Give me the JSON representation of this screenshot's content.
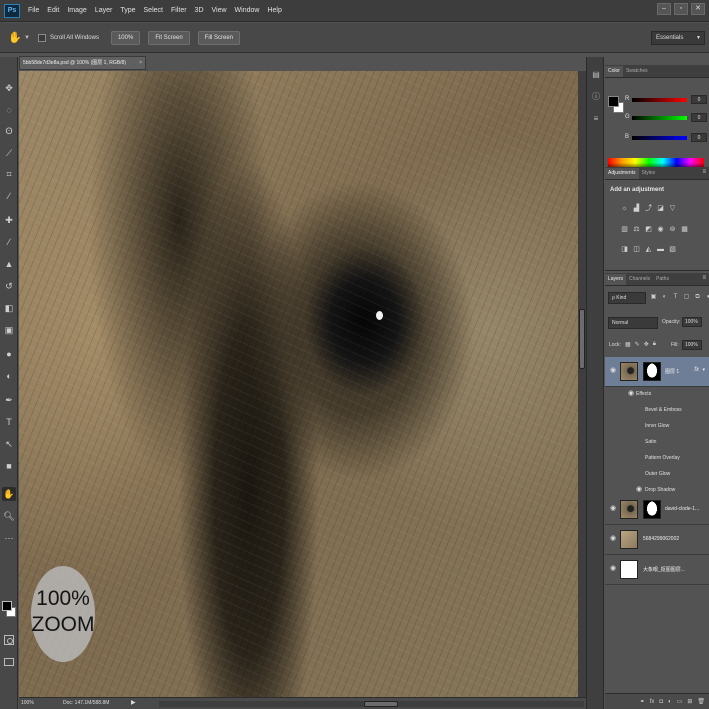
{
  "app": {
    "logo": "Ps"
  },
  "menu": [
    "File",
    "Edit",
    "Image",
    "Layer",
    "Type",
    "Select",
    "Filter",
    "3D",
    "View",
    "Window",
    "Help"
  ],
  "window_buttons": {
    "minimize": "–",
    "restore": "▫",
    "close": "✕"
  },
  "options_bar": {
    "scroll_all_label": "Scroll All Windows",
    "btn_100": "100%",
    "btn_fit": "Fit Screen",
    "btn_fill": "Fill Screen",
    "workspace": "Essentials"
  },
  "document": {
    "tab_title": "5bb58de7d3e8a.psd @ 100% (图层 1, RGB/8)",
    "overlay_badge": {
      "line1": "100%",
      "line2": "ZOOM"
    }
  },
  "status_bar": {
    "zoom": "100%",
    "doc_size": "Doc: 147.1M/588.8M",
    "arrow": "▶"
  },
  "panels": {
    "color": {
      "tabs": [
        "Color",
        "Swatches"
      ],
      "channels": [
        {
          "label": "R",
          "value": "0",
          "color": "#d02020"
        },
        {
          "label": "G",
          "value": "0",
          "color": "#20b020"
        },
        {
          "label": "B",
          "value": "0",
          "color": "#2040d0"
        }
      ]
    },
    "adjustments": {
      "tabs": [
        "Adjustments",
        "Styles"
      ],
      "title": "Add an adjustment"
    },
    "layers": {
      "tabs": [
        "Layers",
        "Channels",
        "Paths"
      ],
      "kind": "ρ Kind",
      "blend_mode": "Normal",
      "opacity_label": "Opacity:",
      "opacity": "100%",
      "lock_label": "Lock:",
      "fill_label": "Fill:",
      "fill": "100%",
      "items": [
        {
          "name": "图层 1",
          "fx": "fx",
          "selected": true
        },
        {
          "name": "david-clode-1...",
          "fx": "",
          "selected": false
        },
        {
          "name": "5684299062002",
          "fx": "",
          "selected": false
        },
        {
          "name": "大象眼_抠图图层...",
          "fx": "",
          "selected": false
        }
      ],
      "effects_label": "Effects",
      "effects": [
        "Bevel & Emboss",
        "Inner Glow",
        "Satin",
        "Pattern Overlay",
        "Outer Glow",
        "Drop Shadow"
      ]
    }
  }
}
